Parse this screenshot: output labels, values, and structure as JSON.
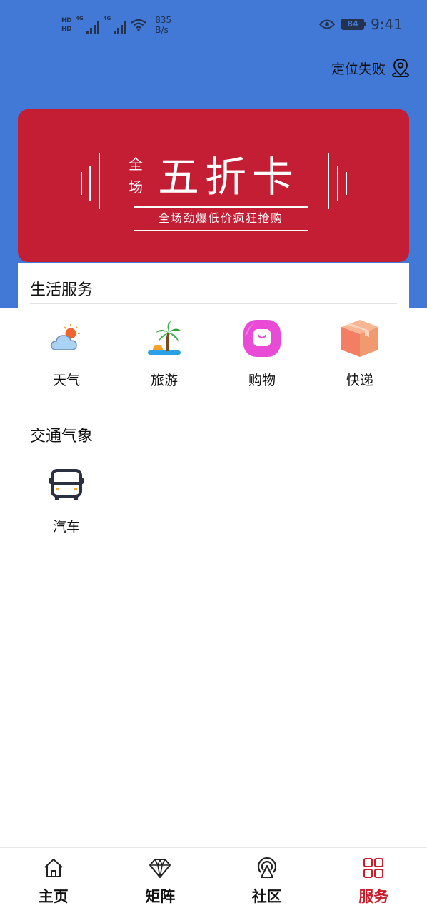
{
  "status_bar": {
    "hd1": "HD",
    "hd2": "HD",
    "net1": "4G",
    "net2": "4G",
    "speed_value": "835",
    "speed_unit": "B/s",
    "battery": "84",
    "time": "9:41"
  },
  "location": {
    "label": "定位失败",
    "icon": "location-pin-icon"
  },
  "banner": {
    "small_text_1": "全",
    "small_text_2": "场",
    "title": "五折卡",
    "subtitle": "全场劲爆低价疯狂抢购",
    "background": "#c41e35"
  },
  "sections": {
    "life": {
      "title": "生活服务",
      "items": [
        {
          "label": "天气",
          "icon": "weather-icon"
        },
        {
          "label": "旅游",
          "icon": "travel-palm-icon"
        },
        {
          "label": "购物",
          "icon": "shopping-bag-icon"
        },
        {
          "label": "快递",
          "icon": "package-box-icon"
        }
      ]
    },
    "traffic": {
      "title": "交通气象",
      "items": [
        {
          "label": "汽车",
          "icon": "bus-icon"
        }
      ]
    }
  },
  "bottom_nav": {
    "items": [
      {
        "label": "主页",
        "icon": "home-icon"
      },
      {
        "label": "矩阵",
        "icon": "diamond-icon"
      },
      {
        "label": "社区",
        "icon": "broadcast-icon"
      },
      {
        "label": "服务",
        "icon": "grid-icon"
      }
    ],
    "active_index": 3,
    "active_color": "#c81d2b"
  },
  "colors": {
    "header_blue": "#4278d6",
    "text": "#111111"
  }
}
